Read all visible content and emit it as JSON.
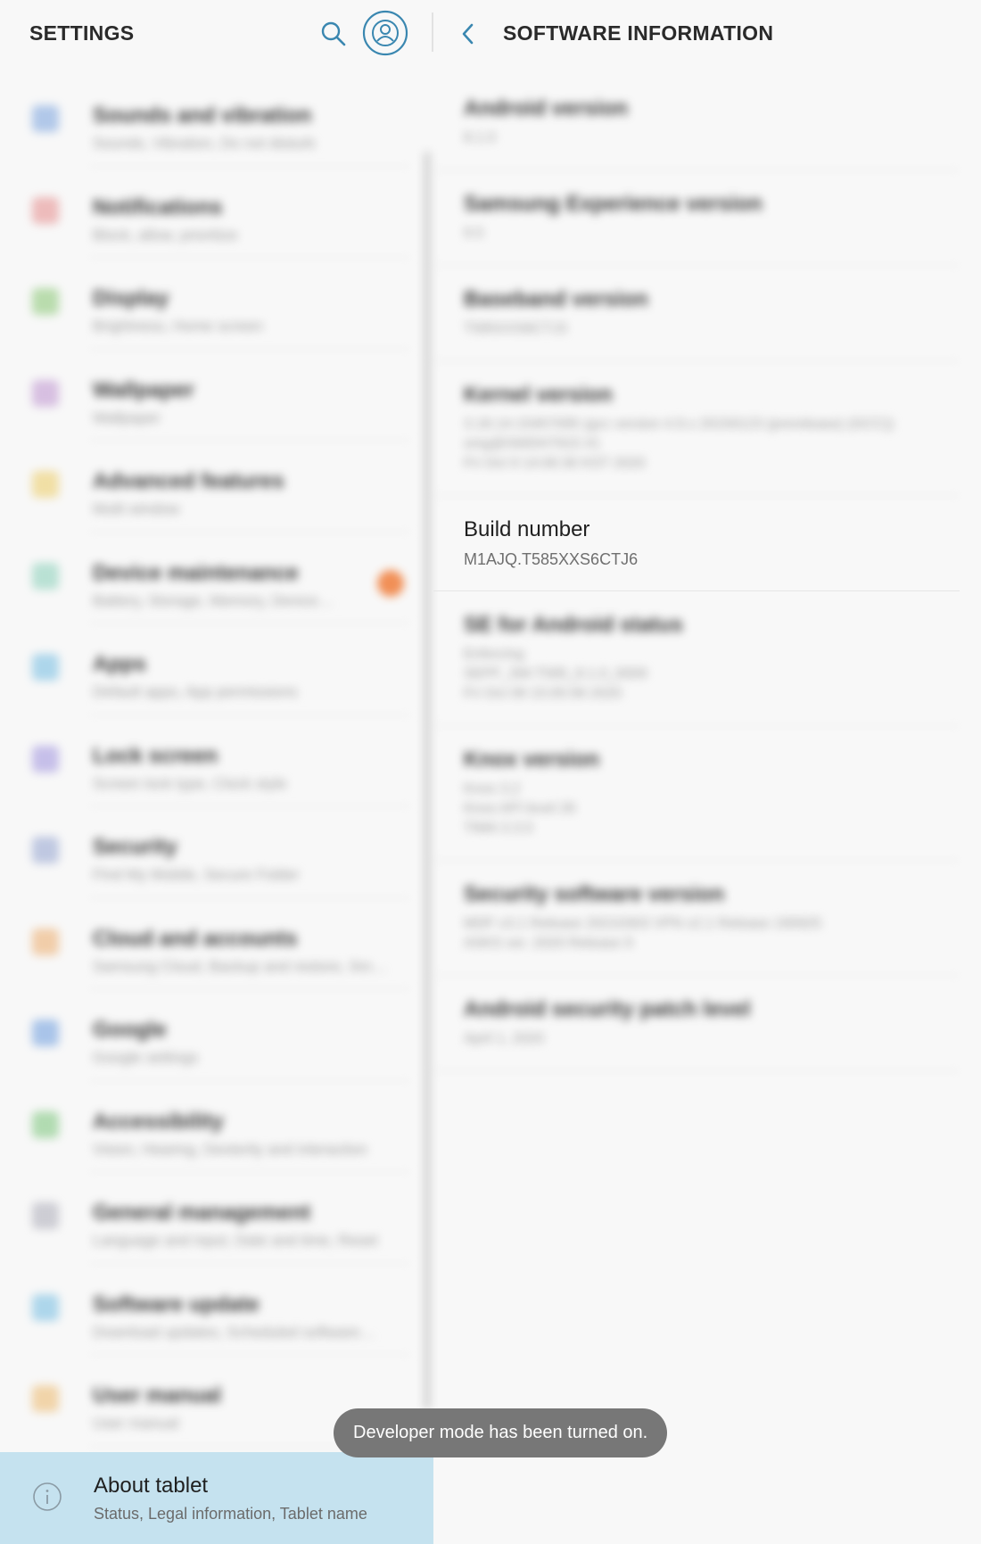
{
  "left_header": {
    "title": "SETTINGS",
    "search_icon": "search-icon",
    "account_icon": "account-circle-icon"
  },
  "right_header": {
    "title": "SOFTWARE INFORMATION",
    "back_icon": "chevron-left-icon"
  },
  "settings_items": [
    {
      "label": "Sounds and vibration",
      "subtitle": "Sounds, Vibration, Do not disturb",
      "icon": "sound-icon",
      "color": "#5b8fd6"
    },
    {
      "label": "Notifications",
      "subtitle": "Block, allow, prioritize",
      "icon": "notification-icon",
      "color": "#e07070"
    },
    {
      "label": "Display",
      "subtitle": "Brightness, Home screen",
      "icon": "display-icon",
      "color": "#6dbb52"
    },
    {
      "label": "Wallpaper",
      "subtitle": "Wallpaper",
      "icon": "wallpaper-icon",
      "color": "#b07ac6"
    },
    {
      "label": "Advanced features",
      "subtitle": "Multi window",
      "icon": "advanced-features-icon",
      "color": "#e8c040"
    },
    {
      "label": "Device maintenance",
      "subtitle": "Battery, Storage, Memory, Device…",
      "icon": "device-maintenance-icon",
      "color": "#6cc6a8"
    },
    {
      "label": "Apps",
      "subtitle": "Default apps, App permissions",
      "icon": "apps-icon",
      "color": "#52aedc"
    },
    {
      "label": "Lock screen",
      "subtitle": "Screen lock type, Clock style",
      "icon": "lock-screen-icon",
      "color": "#8a7ad6"
    },
    {
      "label": "Security",
      "subtitle": "Find My Mobile, Secure Folder",
      "icon": "shield-icon",
      "color": "#7a8fc6"
    },
    {
      "label": "Cloud and accounts",
      "subtitle": "Samsung Cloud, Backup and restore, Sm…",
      "icon": "key-icon",
      "color": "#e89a4a"
    },
    {
      "label": "Google",
      "subtitle": "Google settings",
      "icon": "google-icon",
      "color": "#4a86d8"
    },
    {
      "label": "Accessibility",
      "subtitle": "Vision, Hearing, Dexterity and interaction",
      "icon": "accessibility-icon",
      "color": "#5cb85c"
    },
    {
      "label": "General management",
      "subtitle": "Language and input, Date and time, Reset",
      "icon": "general-management-icon",
      "color": "#9a9aa8"
    },
    {
      "label": "Software update",
      "subtitle": "Download updates, Scheduled software…",
      "icon": "software-update-icon",
      "color": "#52aedc"
    },
    {
      "label": "User manual",
      "subtitle": "User manual",
      "icon": "user-manual-icon",
      "color": "#e8a84a"
    }
  ],
  "selected_item": {
    "label": "About tablet",
    "subtitle": "Status, Legal information, Tablet name",
    "icon": "info-icon"
  },
  "software_info": [
    {
      "label": "Android version",
      "value": "8.1.0"
    },
    {
      "label": "Samsung Experience version",
      "value": "9.5"
    },
    {
      "label": "Baseband version",
      "value": "T585XXS6CTJ3"
    },
    {
      "label": "Kernel version",
      "value": "3.18.14-15457095 (gcc version 4.9.x 20150123 (prerelease) (GCC))\nsmg@SWDH7915 #1\nFri Oct 9 14:00:30 KST 2020"
    },
    {
      "label": "Build number",
      "value": "M1AJQ.T585XXS6CTJ6",
      "sharp": true
    },
    {
      "label": "SE for Android status",
      "value": "Enforcing\nSEPF_SM-T585_8.1.0_0009\nFri Oct 09 15:05:58 2020"
    },
    {
      "label": "Knox version",
      "value": "Knox 3.2\nKnox API level 26\nTIMA 3.3.0"
    },
    {
      "label": "Security software version",
      "value": "MDF v3.1 Release 20210303 VPN v2.1 Release 190925\nASKS ver. 2020 Release 9"
    },
    {
      "label": "Android security patch level",
      "value": "April 1, 2020"
    }
  ],
  "toast": {
    "text": "Developer mode has been turned on."
  },
  "colors": {
    "selected_bg": "#c5e2ef",
    "accent": "#3a87b0",
    "badge": "#f07d3a",
    "toast_bg": "#777777"
  }
}
